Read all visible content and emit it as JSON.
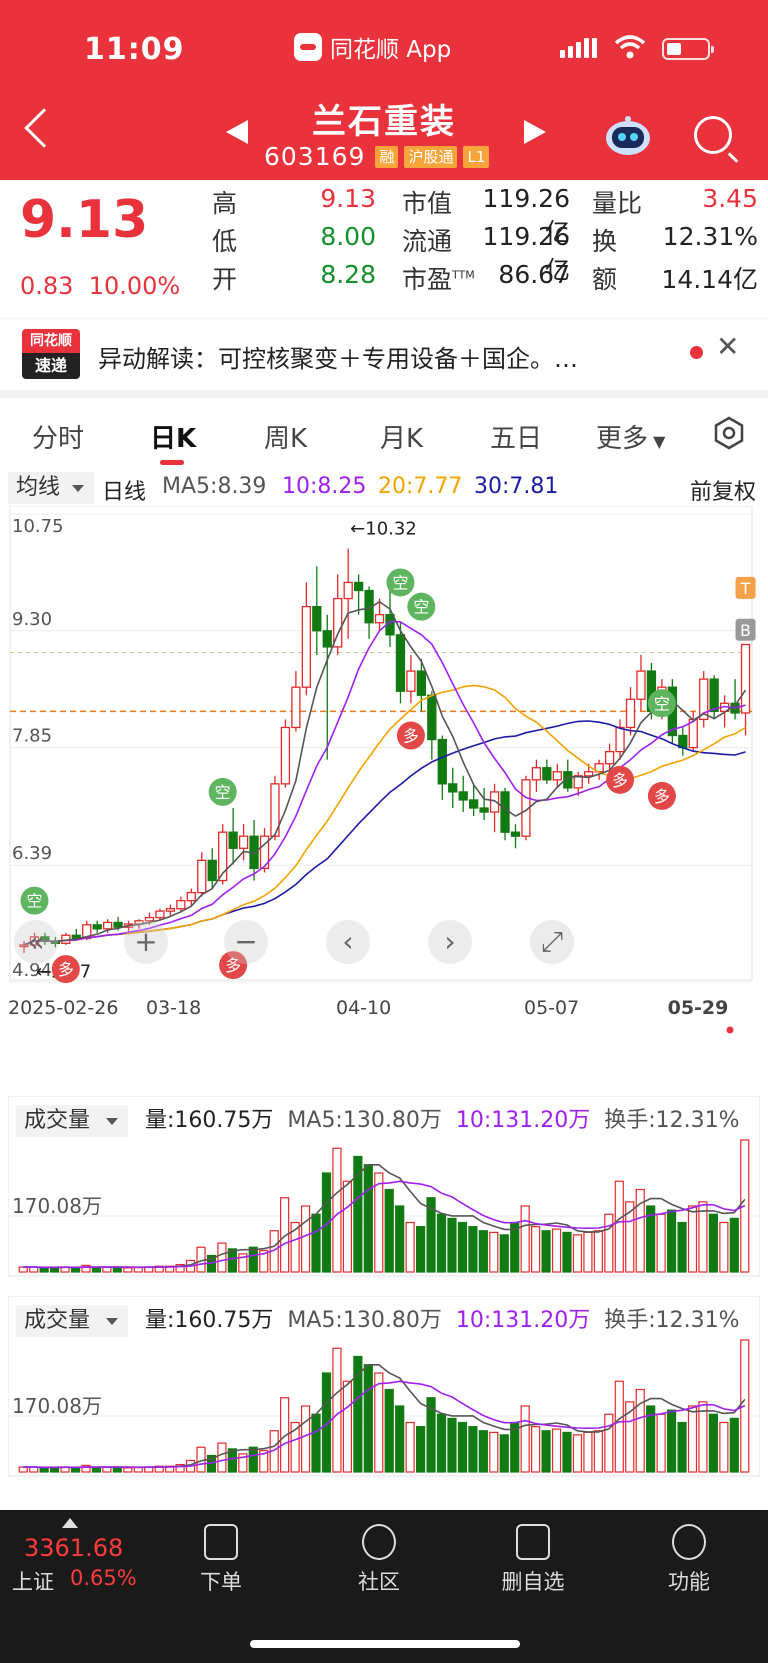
{
  "status_bar": {
    "time": "11:09",
    "app_name": "同花顺 App"
  },
  "header": {
    "stock_name": "兰石重装",
    "stock_code": "603169",
    "tags": [
      "融",
      "沪股通",
      "L1"
    ]
  },
  "quote": {
    "price": "9.13",
    "change": "0.83",
    "change_pct": "10.00%",
    "high_label": "高",
    "high": "9.13",
    "low_label": "低",
    "low": "8.00",
    "open_label": "开",
    "open": "8.28",
    "mktcap_label": "市值",
    "mktcap": "119.26亿",
    "float_label": "流通",
    "float": "119.26亿",
    "pe_label": "市盈",
    "pe_sup": "TTM",
    "pe": "86.67",
    "volratio_label": "量比",
    "volratio": "3.45",
    "turnover_label": "换",
    "turnover": "12.31%",
    "amount_label": "额",
    "amount": "14.14亿"
  },
  "news": {
    "logo_top": "同花顺",
    "logo_bottom": "速递",
    "text": "异动解读：可控核聚变＋专用设备＋国企。…"
  },
  "tabs": [
    "分时",
    "日K",
    "周K",
    "月K",
    "五日",
    "更多"
  ],
  "active_tab": "日K",
  "ma_row": {
    "select": "均线",
    "period": "日线",
    "ma5": "MA5:8.39",
    "ma10": "10:8.25",
    "ma20": "20:7.77",
    "ma30": "30:7.81",
    "adjust": "前复权"
  },
  "chart_data": {
    "type": "candlestick",
    "y_ticks": [
      "10.75",
      "9.30",
      "7.85",
      "6.39",
      "4.94"
    ],
    "ylim": [
      4.94,
      10.75
    ],
    "x_ticks": [
      "2025-02-26",
      "03-18",
      "04-10",
      "05-07",
      "05-29"
    ],
    "annotations": {
      "high": "←10.32",
      "low": "←5.37"
    },
    "signals": [
      "空",
      "空",
      "空",
      "空",
      "空",
      "多",
      "多",
      "多",
      "多",
      "T",
      "B"
    ],
    "candles": [
      [
        5.38,
        5.45,
        5.3,
        5.4
      ],
      [
        5.4,
        5.55,
        5.35,
        5.5
      ],
      [
        5.5,
        5.55,
        5.4,
        5.45
      ],
      [
        5.45,
        5.5,
        5.37,
        5.42
      ],
      [
        5.42,
        5.55,
        5.4,
        5.52
      ],
      [
        5.52,
        5.6,
        5.45,
        5.48
      ],
      [
        5.48,
        5.7,
        5.46,
        5.65
      ],
      [
        5.65,
        5.7,
        5.55,
        5.6
      ],
      [
        5.6,
        5.72,
        5.55,
        5.68
      ],
      [
        5.68,
        5.75,
        5.58,
        5.62
      ],
      [
        5.62,
        5.7,
        5.55,
        5.66
      ],
      [
        5.66,
        5.72,
        5.6,
        5.7
      ],
      [
        5.7,
        5.8,
        5.65,
        5.74
      ],
      [
        5.74,
        5.85,
        5.7,
        5.82
      ],
      [
        5.82,
        5.9,
        5.75,
        5.85
      ],
      [
        5.85,
        6.0,
        5.8,
        5.95
      ],
      [
        5.95,
        6.1,
        5.88,
        6.05
      ],
      [
        6.05,
        6.55,
        6.0,
        6.45
      ],
      [
        6.45,
        6.6,
        6.1,
        6.2
      ],
      [
        6.2,
        6.9,
        6.15,
        6.8
      ],
      [
        6.8,
        7.1,
        6.4,
        6.6
      ],
      [
        6.6,
        6.9,
        6.45,
        6.75
      ],
      [
        6.75,
        6.95,
        6.2,
        6.35
      ],
      [
        6.35,
        6.85,
        6.3,
        6.75
      ],
      [
        6.75,
        7.5,
        6.7,
        7.4
      ],
      [
        7.4,
        8.2,
        7.35,
        8.1
      ],
      [
        8.1,
        8.8,
        8.05,
        8.6
      ],
      [
        8.6,
        9.9,
        8.5,
        9.6
      ],
      [
        9.6,
        10.1,
        9.0,
        9.3
      ],
      [
        9.3,
        9.5,
        7.7,
        9.1
      ],
      [
        9.1,
        10.0,
        9.0,
        9.7
      ],
      [
        9.7,
        10.32,
        9.2,
        9.9
      ],
      [
        9.9,
        10.0,
        9.5,
        9.8
      ],
      [
        9.8,
        9.85,
        9.2,
        9.4
      ],
      [
        9.4,
        9.7,
        9.3,
        9.5
      ],
      [
        9.5,
        9.8,
        9.1,
        9.25
      ],
      [
        9.25,
        9.4,
        8.4,
        8.55
      ],
      [
        8.55,
        9.0,
        8.4,
        8.8
      ],
      [
        8.8,
        8.95,
        8.3,
        8.5
      ],
      [
        8.5,
        8.55,
        7.7,
        7.95
      ],
      [
        7.95,
        8.0,
        7.2,
        7.4
      ],
      [
        7.4,
        7.6,
        7.1,
        7.3
      ],
      [
        7.3,
        7.5,
        7.05,
        7.2
      ],
      [
        7.2,
        7.4,
        7.0,
        7.1
      ],
      [
        7.1,
        7.35,
        6.95,
        7.05
      ],
      [
        7.05,
        7.4,
        6.8,
        7.3
      ],
      [
        7.3,
        7.35,
        6.7,
        6.8
      ],
      [
        6.8,
        6.9,
        6.6,
        6.75
      ],
      [
        6.75,
        7.5,
        6.7,
        7.45
      ],
      [
        7.45,
        7.7,
        7.3,
        7.6
      ],
      [
        7.6,
        7.7,
        7.4,
        7.45
      ],
      [
        7.45,
        7.65,
        7.35,
        7.55
      ],
      [
        7.55,
        7.7,
        7.3,
        7.35
      ],
      [
        7.35,
        7.55,
        7.25,
        7.5
      ],
      [
        7.5,
        7.65,
        7.4,
        7.55
      ],
      [
        7.55,
        7.7,
        7.45,
        7.65
      ],
      [
        7.65,
        7.9,
        7.55,
        7.8
      ],
      [
        7.8,
        8.2,
        7.7,
        8.1
      ],
      [
        8.1,
        8.6,
        8.0,
        8.45
      ],
      [
        8.45,
        9.0,
        8.3,
        8.8
      ],
      [
        8.8,
        8.9,
        8.2,
        8.3
      ],
      [
        8.3,
        8.7,
        8.2,
        8.6
      ],
      [
        8.6,
        8.7,
        7.9,
        8.0
      ],
      [
        8.0,
        8.1,
        7.75,
        7.85
      ],
      [
        7.85,
        8.3,
        7.8,
        8.2
      ],
      [
        8.2,
        8.8,
        8.1,
        8.7
      ],
      [
        8.7,
        8.75,
        8.2,
        8.3
      ],
      [
        8.3,
        8.5,
        8.1,
        8.4
      ],
      [
        8.4,
        8.7,
        8.2,
        8.28
      ],
      [
        8.28,
        9.13,
        8.0,
        9.13
      ]
    ],
    "ma": {
      "MA5": {
        "color": "#555555"
      },
      "MA10": {
        "color": "#a020f0"
      },
      "MA20": {
        "color": "#f5a300"
      },
      "MA30": {
        "color": "#1a1aa8"
      }
    }
  },
  "volume_panels": [
    {
      "select": "成交量",
      "vol": "量:160.75万",
      "ma5": "MA5:130.80万",
      "ma10": "10:131.20万",
      "turnover": "换手:12.31%",
      "y_label": "170.08万"
    },
    {
      "select": "成交量",
      "vol": "量:160.75万",
      "ma5": "MA5:130.80万",
      "ma10": "10:131.20万",
      "turnover": "换手:12.31%",
      "y_label": "170.08万"
    }
  ],
  "volume_data": [
    6,
    6,
    5,
    6,
    6,
    5,
    8,
    5,
    6,
    6,
    5,
    6,
    6,
    7,
    7,
    9,
    14,
    30,
    20,
    35,
    28,
    22,
    30,
    26,
    50,
    90,
    60,
    80,
    70,
    120,
    150,
    110,
    140,
    130,
    120,
    100,
    80,
    60,
    55,
    90,
    70,
    65,
    60,
    55,
    50,
    48,
    45,
    60,
    80,
    55,
    50,
    52,
    48,
    45,
    48,
    50,
    70,
    110,
    85,
    100,
    80,
    70,
    75,
    60,
    80,
    85,
    70,
    60,
    65,
    160
  ],
  "bottom_bar": {
    "index_value": "3361.68",
    "index_name": "上证",
    "index_pct": "0.65%",
    "nav": [
      "下单",
      "社区",
      "删自选",
      "功能"
    ]
  }
}
